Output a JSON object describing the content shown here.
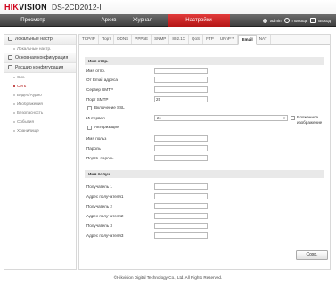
{
  "header": {
    "logo_hik": "HIK",
    "logo_vision": "VISION",
    "device_name": "DS-2CD2012-I"
  },
  "nav": {
    "tabs": [
      {
        "label": "Просмотр",
        "active": false
      },
      {
        "label": "Архив",
        "active": false
      },
      {
        "label": "Журнал",
        "active": false
      },
      {
        "label": "Настройки",
        "active": true
      }
    ],
    "username": "admin",
    "help_label": "Помощь",
    "logout_label": "Выход"
  },
  "sidebar": {
    "sections": [
      {
        "label": "Локальные настр.",
        "items": [
          {
            "label": "Локальные настр.",
            "active": false
          }
        ]
      },
      {
        "label": "Основная конфигурация",
        "items": []
      },
      {
        "label": "Расшир конфигурация",
        "items": [
          {
            "label": "Сис.",
            "active": false
          },
          {
            "label": "Сеть",
            "active": true
          },
          {
            "label": "Видео/Аудио",
            "active": false
          },
          {
            "label": "Изображения",
            "active": false
          },
          {
            "label": "Безопасность",
            "active": false
          },
          {
            "label": "События",
            "active": false
          },
          {
            "label": "Хранилище",
            "active": false
          }
        ]
      }
    ]
  },
  "subtabs": [
    {
      "label": "TCP/IP",
      "active": false
    },
    {
      "label": "Порт",
      "active": false
    },
    {
      "label": "DDNS",
      "active": false
    },
    {
      "label": "PPPoE",
      "active": false
    },
    {
      "label": "SNMP",
      "active": false
    },
    {
      "label": "802.1X",
      "active": false
    },
    {
      "label": "QoS",
      "active": false
    },
    {
      "label": "FTP",
      "active": false
    },
    {
      "label": "UPnP™",
      "active": false
    },
    {
      "label": "Email",
      "active": true
    },
    {
      "label": "NAT",
      "active": false
    }
  ],
  "sender": {
    "heading": "Имя отпр.",
    "fields": {
      "name_label": "Имя отпр.",
      "name_value": "",
      "email_label": "От Email адреса",
      "email_value": "",
      "smtp_label": "Сервер SMTP",
      "smtp_value": "",
      "port_label": "Порт SMTP",
      "port_value": "25"
    },
    "ssl_label": "Включение SSL",
    "interval_label": "Интервал",
    "interval_value": "2с",
    "attach_label": "Вложенное изображение",
    "auth_label": "Авторизация",
    "username_label": "Имя польз",
    "password_label": "Пароль",
    "confirm_label": "Подтв. пароль"
  },
  "receivers": {
    "heading": "Имя получ.",
    "items": [
      {
        "name_label": "Получатель 1",
        "addr_label": "Адрес получателя1"
      },
      {
        "name_label": "Получатель 2",
        "addr_label": "Адрес получателя2"
      },
      {
        "name_label": "Получатель 3",
        "addr_label": "Адрес получателя3"
      }
    ]
  },
  "save_label": "Сохр.",
  "footer": "©Hikvision Digital Technology Co., Ltd. All Rights Reserved."
}
